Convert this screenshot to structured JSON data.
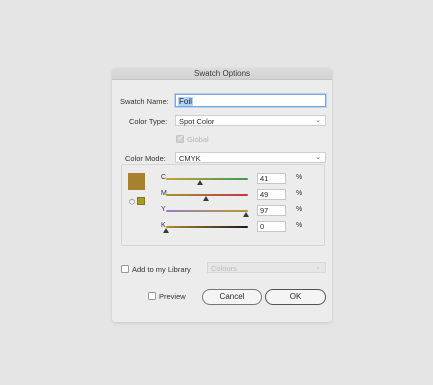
{
  "dialog": {
    "title": "Swatch Options",
    "swatch_name_label": "Swatch Name:",
    "swatch_name_value": "Foil",
    "color_type_label": "Color Type:",
    "color_type_value": "Spot Color",
    "global_label": "Global",
    "global_checked": true,
    "global_enabled": false,
    "color_mode_label": "Color Mode:",
    "color_mode_value": "CMYK",
    "swatch_color": "#a8812f",
    "sliders": [
      {
        "label": "C",
        "value": "41",
        "unit": "%",
        "level": 0.41
      },
      {
        "label": "M",
        "value": "49",
        "unit": "%",
        "level": 0.49
      },
      {
        "label": "Y",
        "value": "97",
        "unit": "%",
        "level": 0.97
      },
      {
        "label": "K",
        "value": "0",
        "unit": "%",
        "level": 0.0
      }
    ],
    "add_to_library_label": "Add to my Library",
    "add_to_library_checked": false,
    "library_value": "Colours",
    "preview_label": "Preview",
    "preview_checked": false,
    "cancel_label": "Cancel",
    "ok_label": "OK",
    "chevron_icon": "chevron-down-icon"
  }
}
